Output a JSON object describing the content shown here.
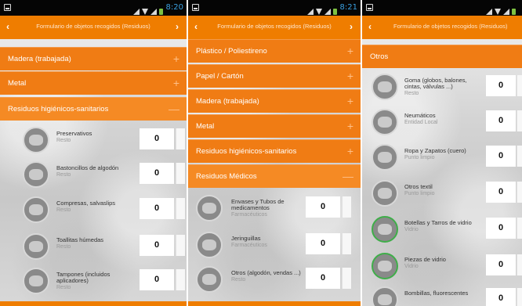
{
  "status": {
    "time_1": "8:20",
    "time_2": "8:21",
    "time_3": ""
  },
  "appbar": {
    "title": "Formulario de objetos recogidos (Residuos)",
    "back": "‹",
    "forward": "›"
  },
  "screen1": {
    "categories": [
      {
        "label": "Madera (trabajada)",
        "sign": "+"
      },
      {
        "label": "Metal",
        "sign": "+"
      },
      {
        "label": "Residuos higiénicos-sanitarios",
        "sign": "—"
      }
    ],
    "items": [
      {
        "name": "Preservativos",
        "sub": "Resto",
        "qty": "0"
      },
      {
        "name": "Bastoncillos de algodón",
        "sub": "Resto",
        "qty": "0"
      },
      {
        "name": "Compresas, salvaslips",
        "sub": "Resto",
        "qty": "0"
      },
      {
        "name": "Toallitas húmedas",
        "sub": "Resto",
        "qty": "0"
      },
      {
        "name": "Tampones (incluidos aplicadores)",
        "sub": "Resto",
        "qty": "0"
      }
    ]
  },
  "screen2": {
    "categories": [
      {
        "label": "Plástico / Poliestireno",
        "sign": "+"
      },
      {
        "label": "Papel / Cartón",
        "sign": "+"
      },
      {
        "label": "Madera (trabajada)",
        "sign": "+"
      },
      {
        "label": "Metal",
        "sign": "+"
      },
      {
        "label": "Residuos higiénicos-sanitarios",
        "sign": "+"
      },
      {
        "label": "Residuos Médicos",
        "sign": "—"
      }
    ],
    "items": [
      {
        "name": "Envases y Tubos de medicamentos",
        "sub": "Farmacéuticos",
        "qty": "0"
      },
      {
        "name": "Jeringuillas",
        "sub": "Farmacéuticos",
        "qty": "0"
      },
      {
        "name": "Otros (algodón, vendas ...)",
        "sub": "Resto",
        "qty": "0"
      }
    ]
  },
  "screen3": {
    "categories": [
      {
        "label": "Otros",
        "sign": ""
      }
    ],
    "items": [
      {
        "name": "Goma (globos, balones, cintas, válvulas ...)",
        "sub": "Resto",
        "qty": "0"
      },
      {
        "name": "Neumáticos",
        "sub": "Entidad Local",
        "qty": "0"
      },
      {
        "name": "Ropa y Zapatos (cuero)",
        "sub": "Punto limpio",
        "qty": "0"
      },
      {
        "name": "Otros textil",
        "sub": "Punto limpio",
        "qty": "0"
      },
      {
        "name": "Botellas y Tarros de vidrio",
        "sub": "Vidrio",
        "qty": "0"
      },
      {
        "name": "Piezas de vidrio",
        "sub": "Vidrio",
        "qty": "0"
      },
      {
        "name": "Bombillas, fluorescentes",
        "sub": "",
        "qty": "0"
      }
    ]
  },
  "colors": {
    "accent": "#ef7d00",
    "header_bg": "#f07c14",
    "status_bar": "#050505",
    "green_ring": "#3fae49"
  },
  "icons": {
    "back": "chevron-left-icon",
    "forward": "chevron-right-icon",
    "expand": "plus-icon",
    "collapse": "minus-icon"
  }
}
